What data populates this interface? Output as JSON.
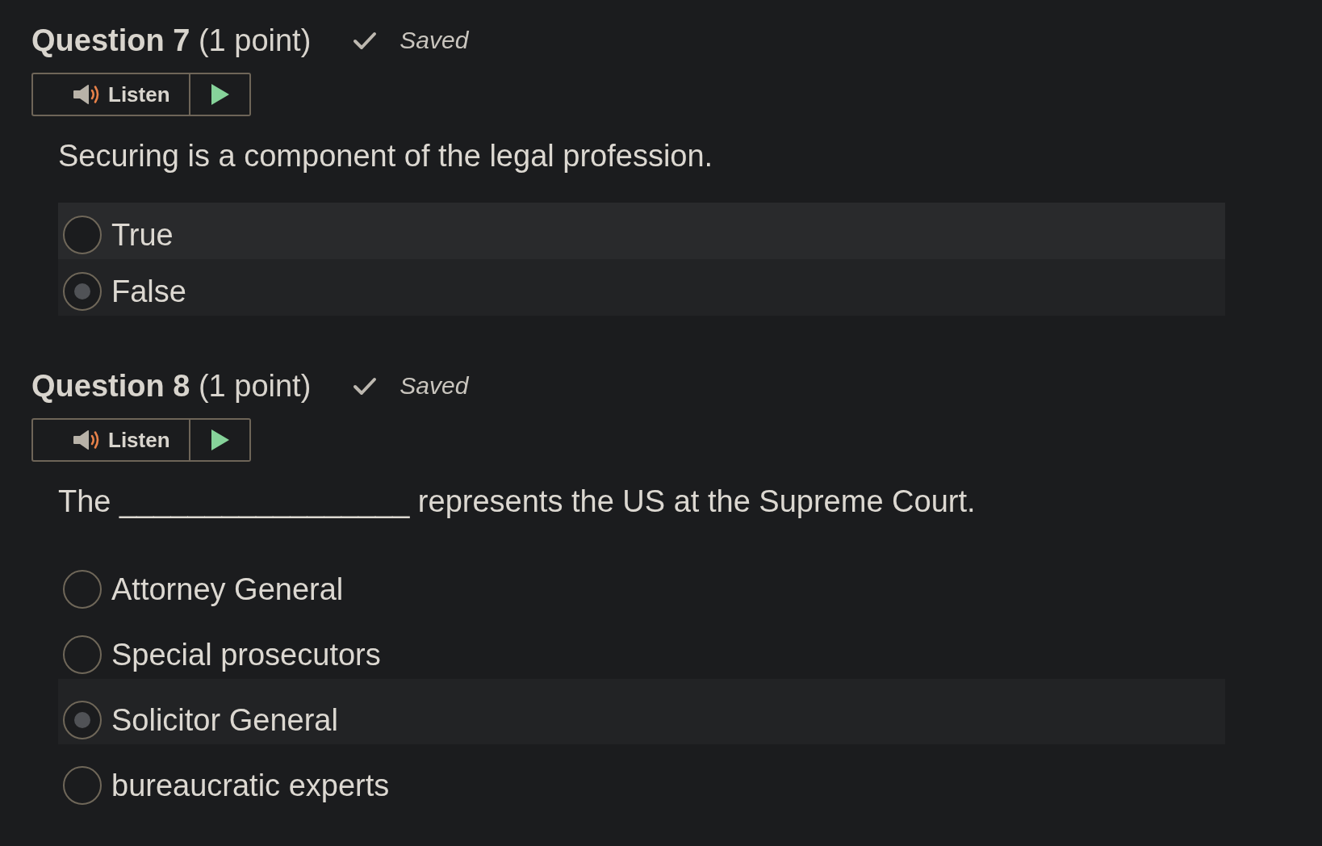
{
  "questions": [
    {
      "heading": "**Question 7** (1 point)",
      "status": "Saved",
      "listen_button": {
        "label": "Listen"
      },
      "prompt": "Securing is a component of the legal profession.",
      "options": [
        {
          "label": "True",
          "selected": false,
          "hovered": true
        },
        {
          "label": "False",
          "selected": true,
          "hovered": false
        }
      ]
    },
    {
      "heading": "**Question 8** (1 point)",
      "status": "Saved",
      "listen_button": {
        "label": "Listen"
      },
      "prompt": "The _________________ represents the US at the Supreme Court.",
      "options": [
        {
          "label": "Attorney General",
          "selected": false,
          "hovered": false
        },
        {
          "label": "Special prosecutors",
          "selected": false,
          "hovered": false
        },
        {
          "label": "Solicitor General",
          "selected": true,
          "hovered": false
        },
        {
          "label": "bureaucratic experts",
          "selected": false,
          "hovered": false
        }
      ]
    }
  ]
}
